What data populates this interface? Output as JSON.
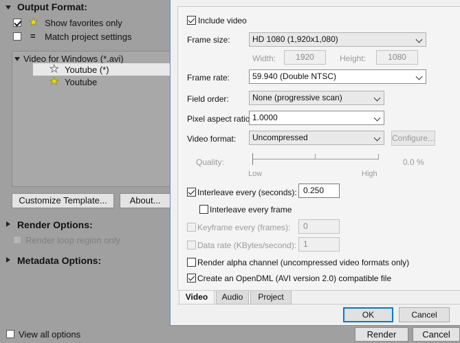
{
  "left": {
    "output_format": {
      "title": "Output Format:",
      "show_favorites": "Show favorites only",
      "match_project": "Match project settings",
      "equals_glyph": "="
    },
    "tree": {
      "root": "Video for Windows (*.avi)",
      "items": [
        {
          "label": "Youtube (*)",
          "selected": true,
          "favorite": false
        },
        {
          "label": "Youtube",
          "selected": false,
          "favorite": true
        }
      ]
    },
    "buttons": {
      "customize": "Customize Template...",
      "about": "About..."
    },
    "render_options": {
      "title": "Render Options:",
      "loop": "Render loop region only"
    },
    "metadata_options": {
      "title": "Metadata Options:"
    },
    "footer": {
      "view_all": "View all options",
      "render": "Render",
      "cancel": "Cancel"
    }
  },
  "dialog": {
    "include_video": "Include video",
    "frame_size": {
      "label": "Frame size:",
      "value": "HD 1080 (1,920x1,080)"
    },
    "width": {
      "label": "Width:",
      "value": "1920"
    },
    "height": {
      "label": "Height:",
      "value": "1080"
    },
    "frame_rate": {
      "label": "Frame rate:",
      "value": "59.940 (Double NTSC)"
    },
    "field_order": {
      "label": "Field order:",
      "value": "None (progressive scan)"
    },
    "pixel_aspect": {
      "label": "Pixel aspect ratio:",
      "value": "1.0000"
    },
    "video_format": {
      "label": "Video format:",
      "value": "Uncompressed",
      "configure": "Configure..."
    },
    "quality": {
      "label": "Quality:",
      "low": "Low",
      "high": "High",
      "value": "0.0 %"
    },
    "interleave_every": {
      "label": "Interleave every (seconds):",
      "value": "0.250"
    },
    "interleave_frame": "Interleave every frame",
    "keyframe": {
      "label": "Keyframe every (frames):",
      "value": "0"
    },
    "data_rate": {
      "label": "Data rate (KBytes/second):",
      "value": "1"
    },
    "render_alpha": "Render alpha channel (uncompressed video formats only)",
    "opendml": "Create an OpenDML (AVI version 2.0) compatible file",
    "tabs": [
      "Video",
      "Audio",
      "Project"
    ],
    "ok": "OK",
    "cancel": "Cancel"
  },
  "colors": {
    "background": "#a0a0a0",
    "dialog": "#f0f0f0",
    "accent": "#0078d7",
    "star": "#f2e400"
  }
}
